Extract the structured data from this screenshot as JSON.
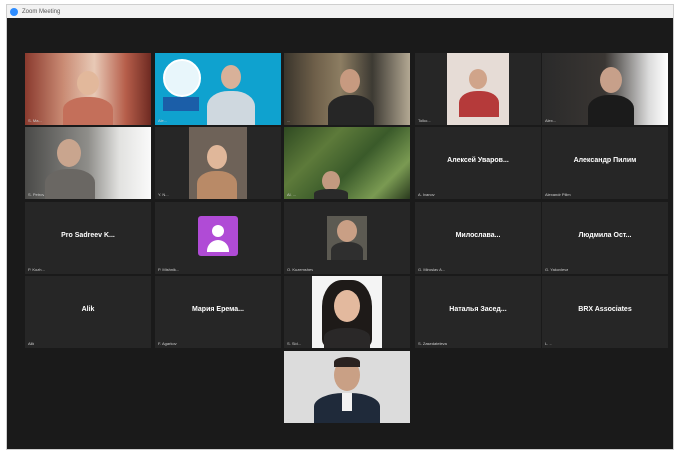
{
  "window": {
    "title": "Zoom Meeting"
  },
  "tiles": [
    {
      "name": "S. Ma..."
    },
    {
      "name": "Ale...",
      "banner": "..."
    },
    {
      "name": "..."
    },
    {
      "name": "Tolko..."
    },
    {
      "name": "Alex..."
    },
    {
      "name": "S. Petrov"
    },
    {
      "name": "Y. N..."
    },
    {
      "name": "Al. ..."
    },
    {
      "name": "A. Ivanov",
      "display": "Алексей Уваров..."
    },
    {
      "name": "Alexandr Pilim",
      "display": "Александр Пилим"
    },
    {
      "name": "P. Kozh...",
      "display": "Pro Sadreev K..."
    },
    {
      "name": "P. Mishnik..."
    },
    {
      "name": "O. Kuzemshev"
    },
    {
      "name": "G. Miroslav A...",
      "display": "Милослава..."
    },
    {
      "name": "G. Yakovleva",
      "display": "Людмила Ост..."
    },
    {
      "name": "Alik",
      "display": "Alik"
    },
    {
      "name": "F. Agarkov",
      "display": "Мария Ерема..."
    },
    {
      "name": "S. Sid..."
    },
    {
      "name": "S. Zasedateleva",
      "display": "Наталья Засед..."
    },
    {
      "name": "L. ..",
      "display": "BRX Associates"
    },
    {
      "name": "..."
    }
  ]
}
